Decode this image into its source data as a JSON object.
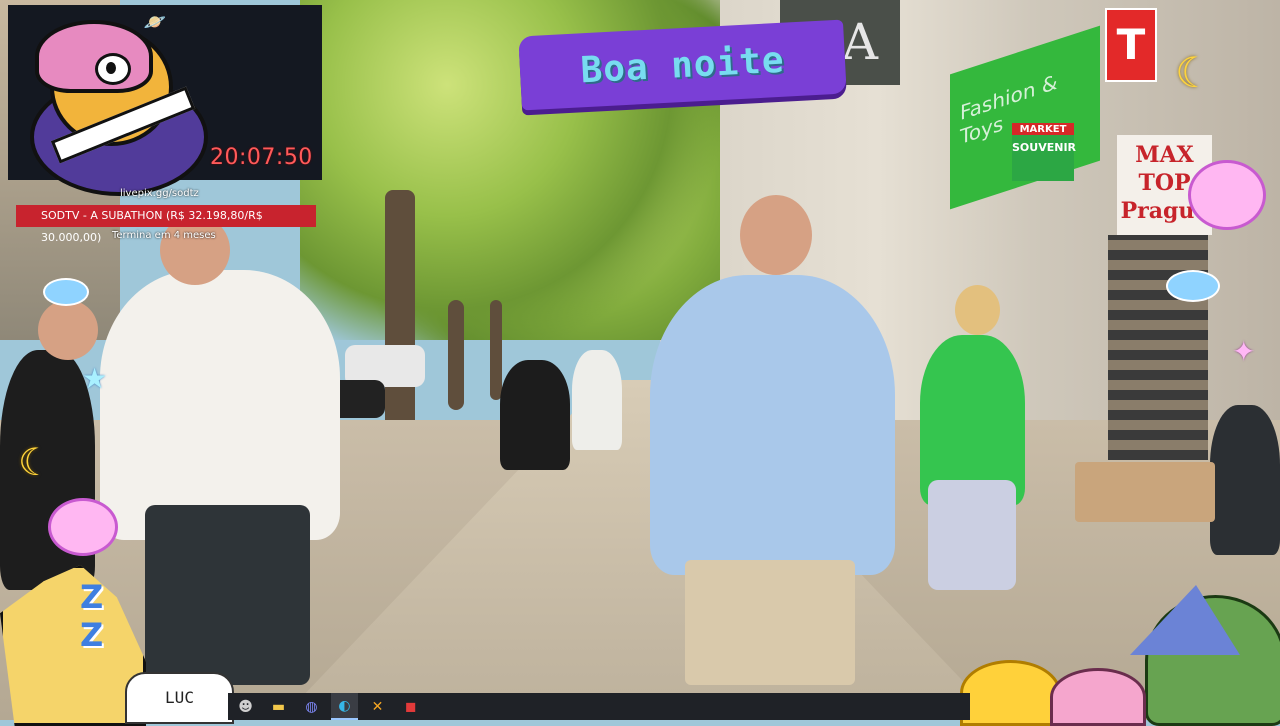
{
  "overlay": {
    "timer": "20:07:50",
    "livepix": "livepix.gg/sodtz",
    "subathon": "SODTV - A SUBATHON (R$ 32.198,80/R$ 30.000,00)",
    "termina": "Termina em 4 meses"
  },
  "banner": {
    "greeting": "Boa noite"
  },
  "scene_signs": {
    "t_sign": "T",
    "shop_text": "Fashion & Toys",
    "market": "MARKET",
    "souvenir": "SOUVENIR",
    "max_top": "MAX TOP",
    "prague": "Prague",
    "g_sign": "GA"
  },
  "ghost": "LUC",
  "taskbar": {
    "items": [
      {
        "icon": "emoji-app-icon",
        "glyph": "☻",
        "color": "#d0d0d0"
      },
      {
        "icon": "file-explorer-icon",
        "glyph": "▬",
        "color": "#f2c84b"
      },
      {
        "icon": "discord-icon",
        "glyph": "◍",
        "color": "#7e88f5"
      },
      {
        "icon": "edge-browser-icon",
        "glyph": "◐",
        "color": "#36b7e8"
      },
      {
        "icon": "streaming-tool-icon",
        "glyph": "✕",
        "color": "#f5a623"
      },
      {
        "icon": "media-app-icon",
        "glyph": "◼",
        "color": "#e23a3a"
      }
    ]
  },
  "colors": {
    "subathon_bar": "#c8232e",
    "timer": "#ff5a5a",
    "banner_bg": "#7a3fd6",
    "banner_text": "#78dcf0"
  }
}
